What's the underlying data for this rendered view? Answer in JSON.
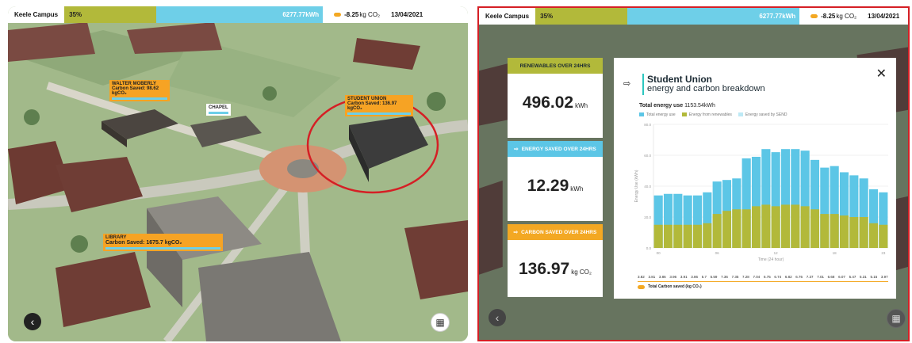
{
  "left": {
    "topbar": {
      "campus": "Keele Campus",
      "percent": "35%",
      "energy_value": "6277.77",
      "energy_unit": "kWh",
      "co2_value": "-8.25",
      "co2_unit": "kg CO₂",
      "date": "13/04/2021"
    },
    "labels": {
      "walter": {
        "name": "WALTER MOBERLY",
        "carbon": "Carbon Saved: 98.62 kgCO₂"
      },
      "chapel": {
        "name": "CHAPEL"
      },
      "union": {
        "name": "STUDENT UNION",
        "carbon": "Carbon Saved: 136.97 kgCO₂"
      },
      "library": {
        "name": "LIBRARY",
        "carbon": "Carbon Saved: 1675.7 kgCO₂"
      }
    }
  },
  "right": {
    "topbar": {
      "campus": "Keele Campus",
      "percent": "35%",
      "energy_value": "6277.77",
      "energy_unit": "kWh",
      "co2_value": "-8.25",
      "co2_unit": "kg CO₂",
      "date": "13/04/2021"
    },
    "cards": [
      {
        "heading": "RENEWABLES OVER 24HRS",
        "value": "496.02",
        "unit": "kWh",
        "color": "#b2b93a"
      },
      {
        "heading": "ENERGY SAVED OVER 24HRS",
        "value": "12.29",
        "unit": "kWh",
        "color": "#5cc6e6"
      },
      {
        "heading": "CARBON SAVED OVER 24HRS",
        "value": "136.97",
        "unit": "kg CO₂",
        "color": "#f3a823"
      }
    ],
    "modal": {
      "title": "Student Union",
      "subtitle": "energy and carbon breakdown",
      "total_label": "Total energy use",
      "total_value": "1153.54kWh",
      "legend": [
        "Total energy use",
        "Energy from renewables",
        "Energy saved by SEND"
      ],
      "carbon_label": "Total Carbon saved (kg CO₂)"
    }
  },
  "chart_data": {
    "type": "bar",
    "xlabel": "Time (24 hour)",
    "ylabel": "Energy Use (kWh)",
    "ylim": [
      0,
      80
    ],
    "yticks": [
      "0.0",
      "20.0",
      "40.0",
      "60.0",
      "80.0"
    ],
    "xticks": [
      "00",
      "06",
      "12",
      "18",
      "23"
    ],
    "categories": [
      "00",
      "01",
      "02",
      "03",
      "04",
      "05",
      "06",
      "07",
      "08",
      "09",
      "10",
      "11",
      "12",
      "13",
      "14",
      "15",
      "16",
      "17",
      "18",
      "19",
      "20",
      "21",
      "22",
      "23"
    ],
    "series": [
      {
        "name": "Total energy use",
        "color": "#5cc6e6",
        "values": [
          34,
          35,
          35,
          34,
          34,
          36,
          43,
          44,
          45,
          58,
          59,
          64,
          62,
          64,
          64,
          63,
          57,
          52,
          53,
          49,
          47,
          45,
          38,
          36
        ]
      },
      {
        "name": "Energy from renewables",
        "color": "#b2b93a",
        "values": [
          15,
          15,
          15,
          15,
          15,
          16,
          22,
          24,
          25,
          25,
          27,
          28,
          27,
          28,
          28,
          27,
          25,
          22,
          22,
          21,
          20,
          20,
          16,
          15
        ]
      }
    ],
    "carbon_saved": [
      "3.82",
      "3.81",
      "3.86",
      "3.96",
      "3.91",
      "3.86",
      "5.7",
      "5.59",
      "7.36",
      "7.35",
      "7.28",
      "7.04",
      "6.75",
      "6.74",
      "6.82",
      "6.76",
      "7.37",
      "7.01",
      "6.68",
      "6.07",
      "5.47",
      "5.31",
      "5.15",
      "3.97"
    ]
  }
}
